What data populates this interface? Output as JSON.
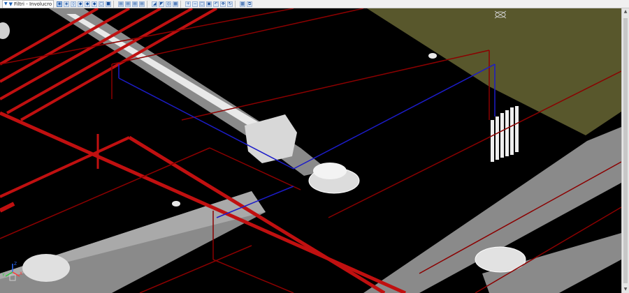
{
  "app": {
    "title": "Filtri - Involucro"
  },
  "toolbar": {
    "filter_label": "Filtri - Involucro",
    "buttons": [
      "view-top-icon",
      "view-front-icon",
      "view-side-icon",
      "view-iso-icon",
      "view-iso-2-icon",
      "view-iso-3-icon",
      "view-wire-icon",
      "view-solid-icon",
      "layer-1-icon",
      "layer-2-icon",
      "layer-3-icon",
      "layer-4-icon",
      "section-icon",
      "measure-icon",
      "snap-icon",
      "grid-icon",
      "zoom-in-icon",
      "zoom-out-icon",
      "zoom-window-icon",
      "zoom-extents-icon",
      "zoom-prev-icon",
      "pan-icon",
      "regenerate-icon",
      "save-icon",
      "copy-icon"
    ]
  },
  "viewport": {
    "background": "#000000",
    "slab_color": "#58572c",
    "duct_color": "#8a8a8a",
    "pipe_color": "#c01010",
    "line_color": "#8b0000",
    "blue_line_color": "#1c1cc8"
  },
  "axis": {
    "x": "X",
    "y": "Y",
    "z": "Z"
  }
}
